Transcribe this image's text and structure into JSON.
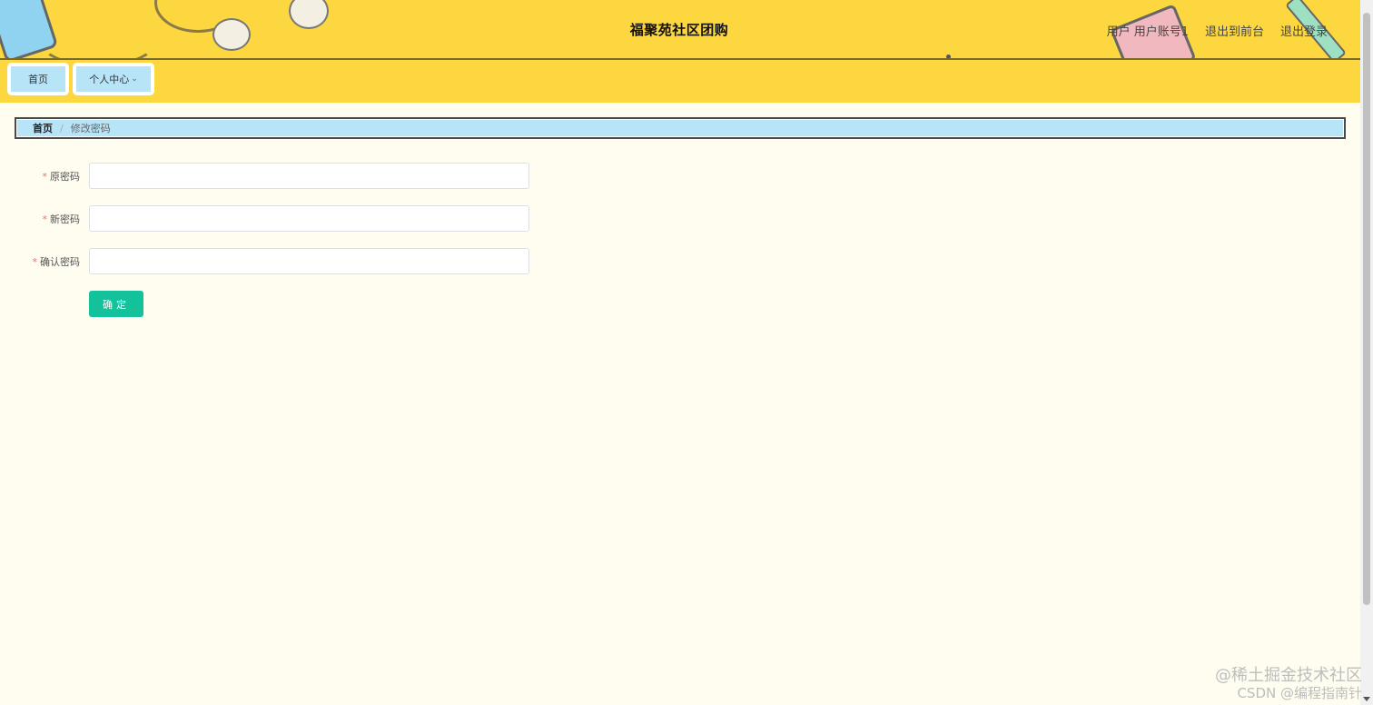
{
  "header": {
    "site_title": "福聚苑社区团购",
    "user_role": "用户",
    "user_account": "用户账号1",
    "back_to_front": "退出到前台",
    "logout": "退出登录"
  },
  "nav": {
    "home": "首页",
    "personal_center": "个人中心"
  },
  "breadcrumb": {
    "home": "首页",
    "separator": "/",
    "current": "修改密码"
  },
  "form": {
    "old_password_label": "原密码",
    "new_password_label": "新密码",
    "confirm_password_label": "确认密码",
    "required_mark": "*",
    "old_password_value": "",
    "new_password_value": "",
    "confirm_password_value": "",
    "submit_label": "确定"
  },
  "watermark": {
    "line1": "@稀土掘金技术社区",
    "line2": "CSDN @编程指南针"
  },
  "colors": {
    "header_bg": "#fdd73f",
    "nav_item_bg": "#b8e4f7",
    "page_bg": "#fffdf0",
    "primary_button": "#13c19a",
    "required": "#f56c6c"
  }
}
